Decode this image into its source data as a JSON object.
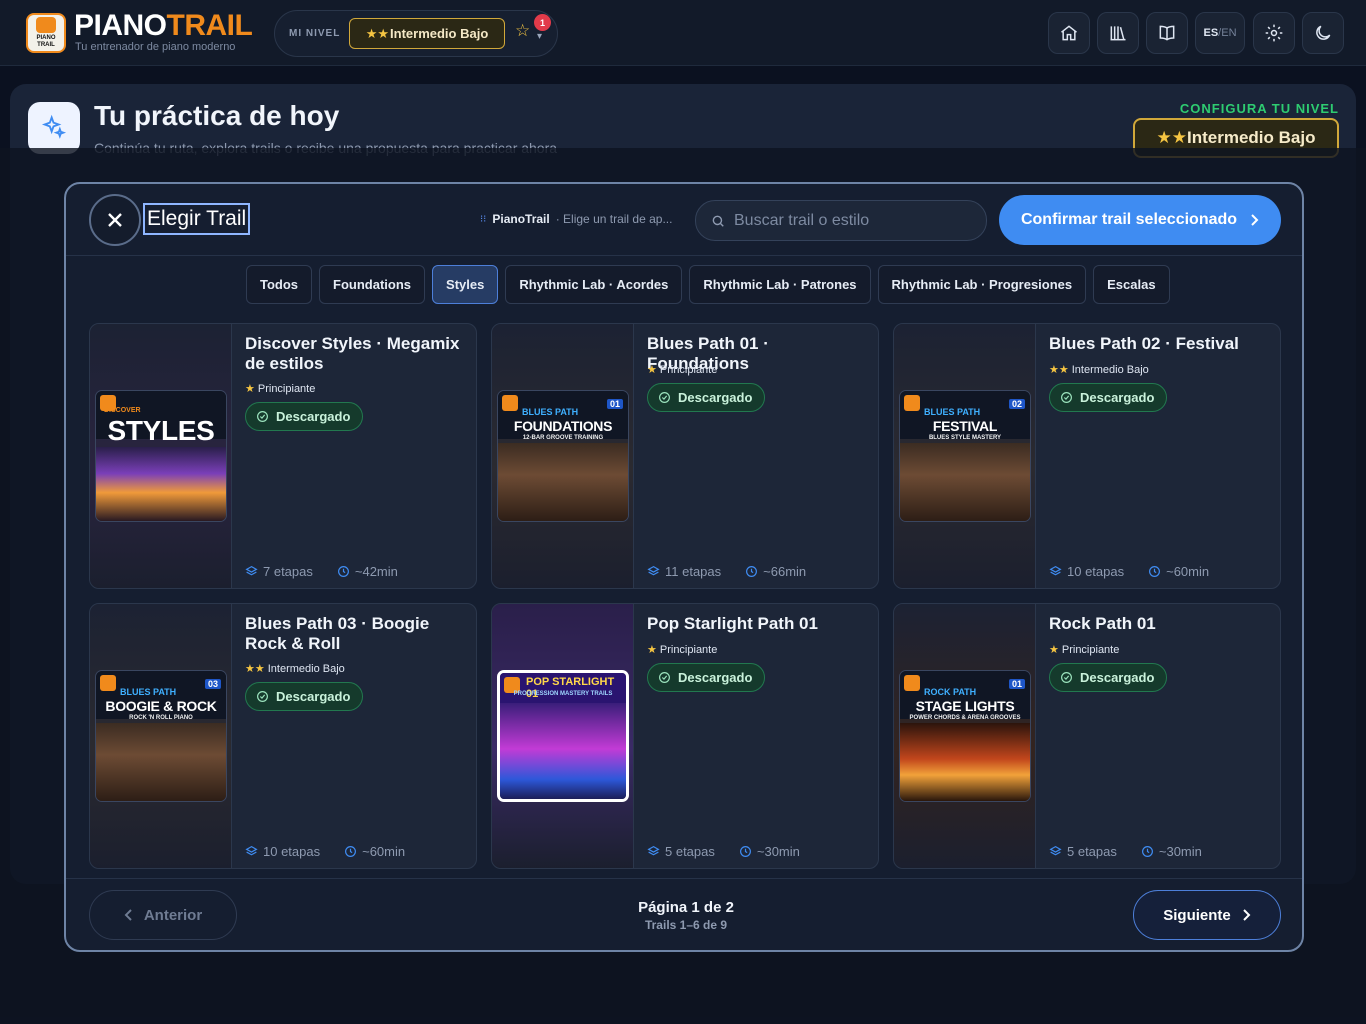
{
  "header": {
    "logo_text": "PIANO TRAIL",
    "brand_a": "PIANO",
    "brand_b": "TRAIL",
    "subtitle": "Tu entrenador de piano moderno",
    "level_label": "MI NIVEL",
    "level_value": "Intermedio Bajo",
    "level_stars": "★★",
    "notification_count": "1",
    "lang_active": "ES",
    "lang_sep": " / ",
    "lang_other": "EN"
  },
  "background": {
    "title": "Tu práctica de hoy",
    "subtitle": "Continúa tu ruta, explora trails o recibe una propuesta para practicar ahora",
    "config_label": "CONFIGURA TU NIVEL",
    "config_level": "Intermedio Bajo",
    "config_stars": "★★"
  },
  "modal": {
    "title": "Elegir Trail",
    "crumb_app": "PianoTrail",
    "crumb_text": "· Elige un trail de ap...",
    "search_placeholder": "Buscar trail o estilo",
    "confirm_label": "Confirmar trail seleccionado",
    "tabs": [
      "Todos",
      "Foundations",
      "Styles",
      "Rhythmic Lab · Acordes",
      "Rhythmic Lab · Patrones",
      "Rhythmic Lab · Progresiones",
      "Escalas"
    ],
    "active_tab": "Styles",
    "cards": [
      {
        "title": "Discover Styles · Megamix de estilos",
        "stars": "★",
        "level": "Principiante",
        "status": "Descargado",
        "stages": "7 etapas",
        "duration": "~42min",
        "cover": {
          "num": "",
          "line1": "DISCOVER",
          "line2": "STYLES",
          "line3": ""
        }
      },
      {
        "title": "Blues Path 01 · Foundations",
        "stars": "★",
        "level": "Principiante",
        "status": "Descargado",
        "stages": "11 etapas",
        "duration": "~66min",
        "cover": {
          "num": "01",
          "line1": "BLUES PATH",
          "line2": "FOUNDATIONS",
          "line3": "12-BAR GROOVE TRAINING"
        }
      },
      {
        "title": "Blues Path 02 · Festival",
        "stars": "★★",
        "level": "Intermedio Bajo",
        "status": "Descargado",
        "stages": "10 etapas",
        "duration": "~60min",
        "cover": {
          "num": "02",
          "line1": "BLUES PATH",
          "line2": "FESTIVAL",
          "line3": "BLUES STYLE MASTERY"
        }
      },
      {
        "title": "Blues Path 03 · Boogie Rock & Roll",
        "stars": "★★",
        "level": "Intermedio Bajo",
        "status": "Descargado",
        "stages": "10 etapas",
        "duration": "~60min",
        "cover": {
          "num": "03",
          "line1": "BLUES PATH",
          "line2": "BOOGIE & ROCK",
          "line3": "ROCK 'N ROLL PIANO"
        }
      },
      {
        "title": "Pop Starlight Path 01",
        "stars": "★",
        "level": "Principiante",
        "status": "Descargado",
        "stages": "5 etapas",
        "duration": "~30min",
        "cover": {
          "num": "",
          "line1": "POP STARLIGHT 01",
          "line2": "",
          "line3": "PROGRESSION MASTERY TRAILS"
        }
      },
      {
        "title": "Rock Path 01",
        "stars": "★",
        "level": "Principiante",
        "status": "Descargado",
        "stages": "5 etapas",
        "duration": "~30min",
        "cover": {
          "num": "01",
          "line1": "ROCK PATH",
          "line2": "STAGE LIGHTS",
          "line3": "POWER CHORDS & ARENA GROOVES"
        }
      }
    ],
    "footer": {
      "prev_label": "Anterior",
      "next_label": "Siguiente",
      "page_label": "Página 1 de 2",
      "range_label": "Trails 1–6 de 9"
    }
  },
  "colors": {
    "accent": "#3f8cf2",
    "brand_orange": "#f08a1c",
    "success": "#2ecc71",
    "gold": "#d1a83a"
  },
  "icons": [
    "home-icon",
    "library-icon",
    "book-icon",
    "settings-icon",
    "moon-icon",
    "search-icon",
    "close-icon",
    "check-circle-icon",
    "layers-icon",
    "clock-icon",
    "chevron-right-icon",
    "chevron-left-icon",
    "sparkle-icon"
  ]
}
